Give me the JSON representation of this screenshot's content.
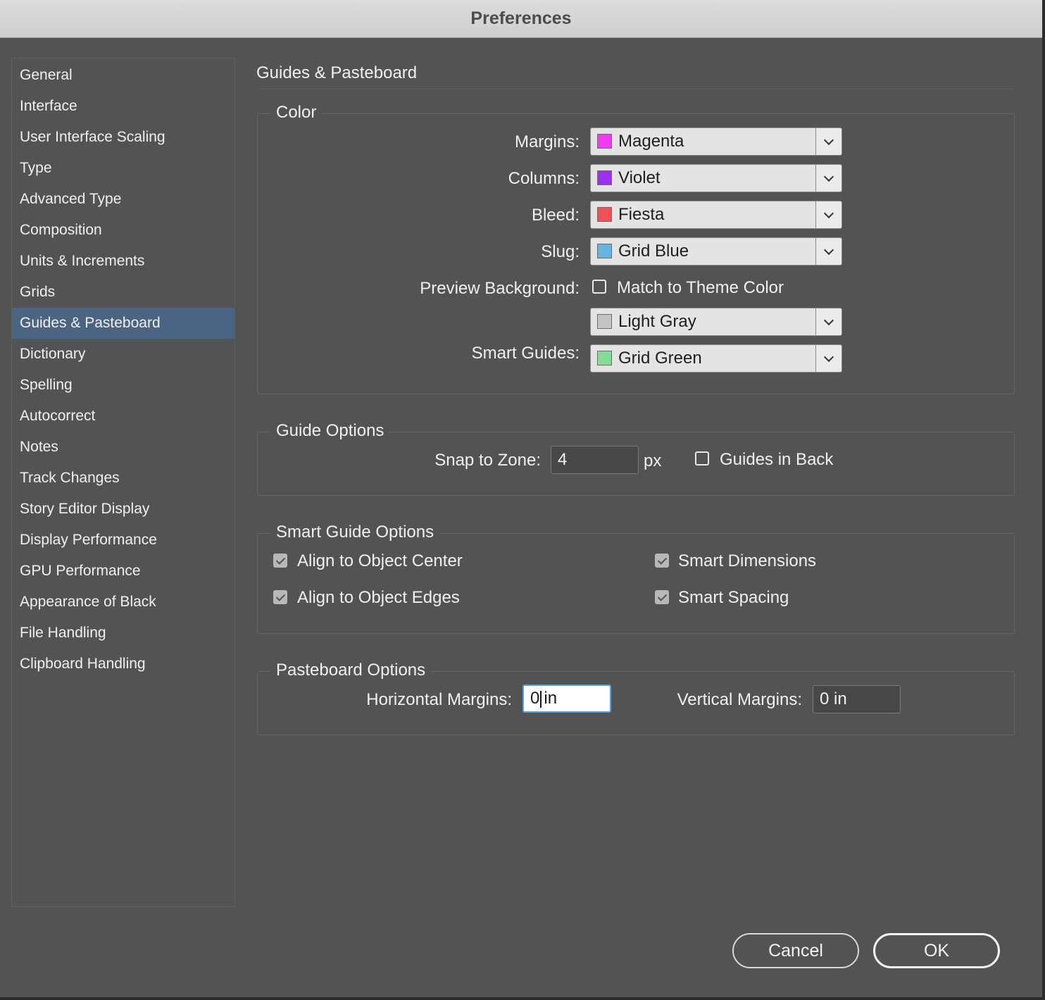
{
  "window": {
    "title": "Preferences"
  },
  "sidebar": {
    "items": [
      {
        "label": "General"
      },
      {
        "label": "Interface"
      },
      {
        "label": "User Interface Scaling"
      },
      {
        "label": "Type"
      },
      {
        "label": "Advanced Type"
      },
      {
        "label": "Composition"
      },
      {
        "label": "Units & Increments"
      },
      {
        "label": "Grids"
      },
      {
        "label": "Guides & Pasteboard"
      },
      {
        "label": "Dictionary"
      },
      {
        "label": "Spelling"
      },
      {
        "label": "Autocorrect"
      },
      {
        "label": "Notes"
      },
      {
        "label": "Track Changes"
      },
      {
        "label": "Story Editor Display"
      },
      {
        "label": "Display Performance"
      },
      {
        "label": "GPU Performance"
      },
      {
        "label": "Appearance of Black"
      },
      {
        "label": "File Handling"
      },
      {
        "label": "Clipboard Handling"
      }
    ],
    "selected": "Guides & Pasteboard"
  },
  "page": {
    "title": "Guides & Pasteboard"
  },
  "color_group": {
    "legend": "Color",
    "margins": {
      "label": "Margins:",
      "value": "Magenta",
      "swatch": "#f03cf0"
    },
    "columns": {
      "label": "Columns:",
      "value": "Violet",
      "swatch": "#9b30f0"
    },
    "bleed": {
      "label": "Bleed:",
      "value": "Fiesta",
      "swatch": "#f0505a"
    },
    "slug": {
      "label": "Slug:",
      "value": "Grid Blue",
      "swatch": "#68b4e0"
    },
    "preview_background": {
      "label": "Preview Background:",
      "checkbox_label": "Match to Theme Color",
      "checked": false,
      "value": "Light Gray",
      "swatch": "#c4c4c4"
    },
    "smart_guides": {
      "label": "Smart Guides:",
      "value": "Grid Green",
      "swatch": "#86dc96"
    }
  },
  "guide_options": {
    "legend": "Guide Options",
    "snap_label": "Snap to Zone:",
    "snap_value": "4",
    "snap_unit": "px",
    "guides_in_back": {
      "label": "Guides in Back",
      "checked": false
    }
  },
  "smart_guide_options": {
    "legend": "Smart Guide Options",
    "align_center": {
      "label": "Align to Object Center",
      "checked": true
    },
    "align_edges": {
      "label": "Align to Object Edges",
      "checked": true
    },
    "smart_dimensions": {
      "label": "Smart Dimensions",
      "checked": true
    },
    "smart_spacing": {
      "label": "Smart Spacing",
      "checked": true
    }
  },
  "pasteboard_options": {
    "legend": "Pasteboard Options",
    "horizontal_label": "Horizontal Margins:",
    "horizontal_value_before_caret": "0",
    "horizontal_value_after_caret": "in",
    "vertical_label": "Vertical Margins:",
    "vertical_value": "0 in"
  },
  "buttons": {
    "cancel": "Cancel",
    "ok": "OK"
  }
}
